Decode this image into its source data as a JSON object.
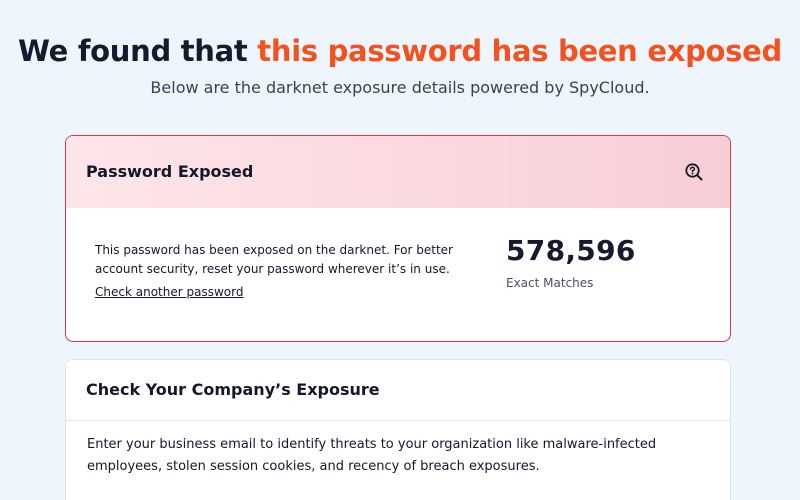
{
  "header": {
    "headline_prefix": "We found that ",
    "headline_accent": "this password has been exposed",
    "subtitle": "Below are the darknet exposure details powered by SpyCloud."
  },
  "exposure_card": {
    "title": "Password Exposed",
    "icon": "search-question-icon",
    "description": "This password has been exposed on the darknet. For better account security, reset your password wherever it’s in use.",
    "link_label": "Check another password",
    "match_count": "578,596",
    "match_label": "Exact Matches"
  },
  "company_card": {
    "title": "Check Your Company’s Exposure",
    "description": "Enter your business email to identify threats to your organization like malware-infected employees, stolen session cookies, and recency of breach exposures."
  },
  "colors": {
    "accent": "#f4511e",
    "alert_border": "#d6394a",
    "page_background": "#eef5fd"
  }
}
